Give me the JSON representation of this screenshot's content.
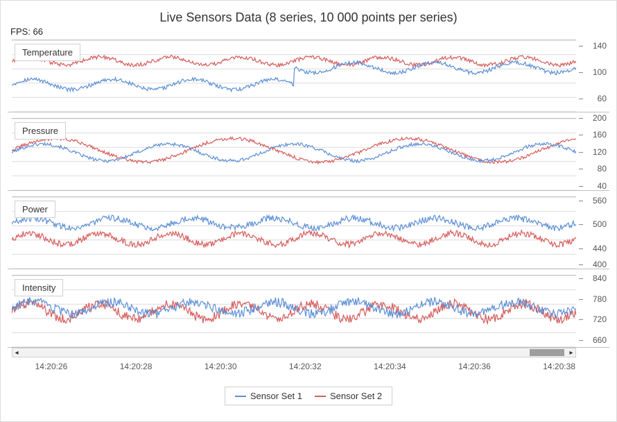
{
  "title": "Live Sensors Data (8 series, 10 000 points per series)",
  "fps_label": "FPS: 66",
  "legend": {
    "s1": "Sensor Set 1",
    "s2": "Sensor Set 2"
  },
  "colors": {
    "s1": "#5b8ed6",
    "s2": "#d65b5b"
  },
  "x_ticks": [
    "14:20:26",
    "14:20:28",
    "14:20:30",
    "14:20:32",
    "14:20:34",
    "14:20:36",
    "14:20:38"
  ],
  "panels": [
    {
      "key": "temperature",
      "label": "Temperature",
      "y_ticks": [
        60,
        100,
        140
      ],
      "y_range": [
        40,
        150
      ],
      "s1_base": 82,
      "s1_amp": 8,
      "s1_jump_at": 0.5,
      "s1_jump_to": 108,
      "s2_base": 118,
      "s2_amp": 6,
      "noise": 3
    },
    {
      "key": "pressure",
      "label": "Pressure",
      "y_ticks": [
        40,
        80,
        120,
        160,
        200
      ],
      "y_range": [
        30,
        200
      ],
      "s1_base": 120,
      "s1_amp": 20,
      "s1_freq": 4.5,
      "s2_base": 125,
      "s2_amp": 28,
      "s2_freq": 3.2,
      "noise": 4
    },
    {
      "key": "power",
      "label": "Power",
      "y_ticks": [
        400,
        440,
        500,
        560
      ],
      "y_range": [
        390,
        570
      ],
      "s1_base": 505,
      "s1_amp": 12,
      "s2_base": 465,
      "s2_amp": 14,
      "noise": 8
    },
    {
      "key": "intensity",
      "label": "Intensity",
      "y_ticks": [
        660,
        720,
        780,
        840
      ],
      "y_range": [
        640,
        850
      ],
      "s1_base": 755,
      "s1_amp": 18,
      "s2_base": 745,
      "s2_amp": 22,
      "noise": 14
    }
  ],
  "chart_data": [
    {
      "type": "line",
      "title": "Temperature",
      "xlabel": "time",
      "ylabel": "",
      "ylim": [
        40,
        150
      ],
      "x_samples": [
        "14:20:26",
        "14:20:28",
        "14:20:30",
        "14:20:32",
        "14:20:34",
        "14:20:36",
        "14:20:38"
      ],
      "series": [
        {
          "name": "Sensor Set 1",
          "values_at_x_samples": [
            80,
            85,
            88,
            92,
            110,
            118,
            108
          ]
        },
        {
          "name": "Sensor Set 2",
          "values_at_x_samples": [
            118,
            120,
            116,
            115,
            112,
            122,
            112
          ]
        }
      ],
      "note": "Sensor Set 1 shows a step jump from ~90 to ~110 near 14:20:31.5"
    },
    {
      "type": "line",
      "title": "Pressure",
      "xlabel": "time",
      "ylabel": "",
      "ylim": [
        30,
        200
      ],
      "x_samples": [
        "14:20:26",
        "14:20:28",
        "14:20:30",
        "14:20:32",
        "14:20:34",
        "14:20:36",
        "14:20:38"
      ],
      "series": [
        {
          "name": "Sensor Set 1",
          "values_at_x_samples": [
            120,
            100,
            140,
            105,
            135,
            115,
            115
          ]
        },
        {
          "name": "Sensor Set 2",
          "values_at_x_samples": [
            115,
            145,
            100,
            135,
            150,
            105,
            160
          ]
        }
      ]
    },
    {
      "type": "line",
      "title": "Power",
      "xlabel": "time",
      "ylabel": "",
      "ylim": [
        390,
        570
      ],
      "x_samples": [
        "14:20:26",
        "14:20:28",
        "14:20:30",
        "14:20:32",
        "14:20:34",
        "14:20:36",
        "14:20:38"
      ],
      "series": [
        {
          "name": "Sensor Set 1",
          "values_at_x_samples": [
            500,
            505,
            500,
            505,
            510,
            505,
            520
          ]
        },
        {
          "name": "Sensor Set 2",
          "values_at_x_samples": [
            460,
            470,
            455,
            460,
            465,
            460,
            475
          ]
        }
      ]
    },
    {
      "type": "line",
      "title": "Intensity",
      "xlabel": "time",
      "ylabel": "",
      "ylim": [
        640,
        850
      ],
      "x_samples": [
        "14:20:26",
        "14:20:28",
        "14:20:30",
        "14:20:32",
        "14:20:34",
        "14:20:36",
        "14:20:38"
      ],
      "series": [
        {
          "name": "Sensor Set 1",
          "values_at_x_samples": [
            750,
            760,
            760,
            755,
            765,
            760,
            745
          ]
        },
        {
          "name": "Sensor Set 2",
          "values_at_x_samples": [
            740,
            770,
            740,
            760,
            760,
            735,
            735
          ]
        }
      ]
    }
  ]
}
